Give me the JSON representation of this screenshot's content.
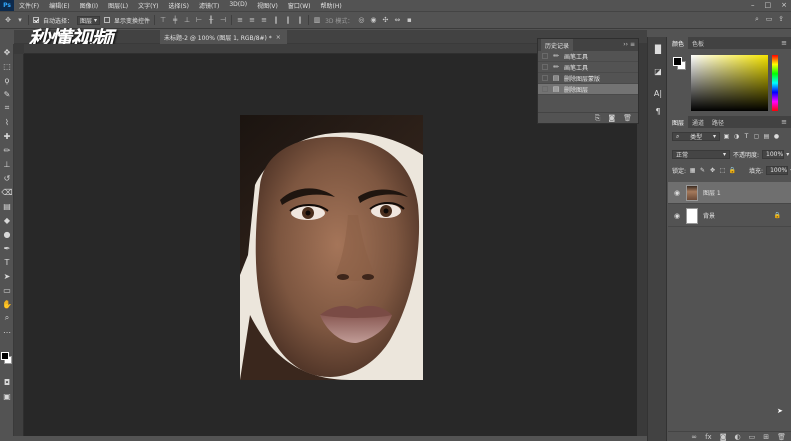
{
  "menubar": {
    "items": [
      "文件(F)",
      "编辑(E)",
      "图像(I)",
      "图层(L)",
      "文字(Y)",
      "选择(S)",
      "滤镜(T)",
      "3D(D)",
      "视图(V)",
      "窗口(W)",
      "帮助(H)"
    ]
  },
  "watermark": "秒懂视频",
  "options": {
    "auto_select_label": "自动选择：",
    "auto_select_value": "图层",
    "show_transform_label": "显示变换控件",
    "mode_3d_label": "3D 模式："
  },
  "document": {
    "tab_title": "未标题-2 @ 100% (图层 1, RGB/8#) *",
    "close_glyph": "×"
  },
  "history": {
    "tab": "历史记录",
    "items": [
      {
        "label": "画笔工具",
        "icon": "brush-icon",
        "active": false
      },
      {
        "label": "画笔工具",
        "icon": "brush-icon",
        "active": false
      },
      {
        "label": "删除图层蒙版",
        "icon": "document-icon",
        "active": false
      },
      {
        "label": "删除图层",
        "icon": "document-icon",
        "active": true
      }
    ]
  },
  "color": {
    "tabs": [
      "颜色",
      "色板"
    ],
    "foreground": "#000000",
    "background": "#ffffff"
  },
  "layers": {
    "tabs": [
      "图层",
      "通道",
      "路径"
    ],
    "filter_label": "类型",
    "blend_mode": "正常",
    "opacity_label": "不透明度:",
    "opacity_value": "100%",
    "lock_label": "锁定:",
    "fill_label": "填充:",
    "fill_value": "100%",
    "items": [
      {
        "name": "图层 1",
        "selected": true,
        "thumb": "face",
        "locked": false
      },
      {
        "name": "背景",
        "selected": false,
        "thumb": "white",
        "locked": true
      }
    ]
  }
}
